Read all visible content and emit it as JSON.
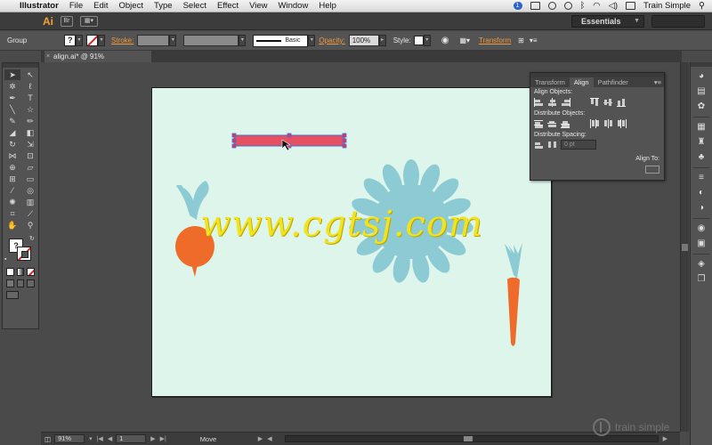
{
  "menubar": {
    "app_name": "Illustrator",
    "items": [
      "File",
      "Edit",
      "Object",
      "Type",
      "Select",
      "Effect",
      "View",
      "Window",
      "Help"
    ],
    "notification_count": "1",
    "user_name": "Train Simple"
  },
  "appbar": {
    "logo": "Ai",
    "bridge_label": "Br",
    "workspace": "Essentials"
  },
  "controlbar": {
    "selection_label": "Group",
    "stroke_label": "Stroke:",
    "brush_label": "Basic",
    "opacity_label": "Opacity:",
    "opacity_value": "100%",
    "style_label": "Style:",
    "transform_label": "Transform"
  },
  "document": {
    "tab_title": "align.ai* @ 91% (CMYK/Preview)",
    "close_glyph": "×"
  },
  "watermark": "www.cgtsj.com",
  "align_panel": {
    "tabs": [
      "Transform",
      "Align",
      "Pathfinder"
    ],
    "active_tab": "Align",
    "align_objects_label": "Align Objects:",
    "distribute_objects_label": "Distribute Objects:",
    "distribute_spacing_label": "Distribute Spacing:",
    "align_to_label": "Align To:",
    "spacing_value": "0 pt"
  },
  "statusbar": {
    "zoom": "91%",
    "artboard_number": "1",
    "status_text": "Move"
  },
  "branding": "train simple",
  "colors": {
    "artboard_bg": "#def5ec",
    "teal": "#8dcbd4",
    "orange": "#ef6b2a",
    "watermark": "#f1e31f",
    "selected_text": "#e8344a",
    "accent_orange": "#f09a3e"
  }
}
